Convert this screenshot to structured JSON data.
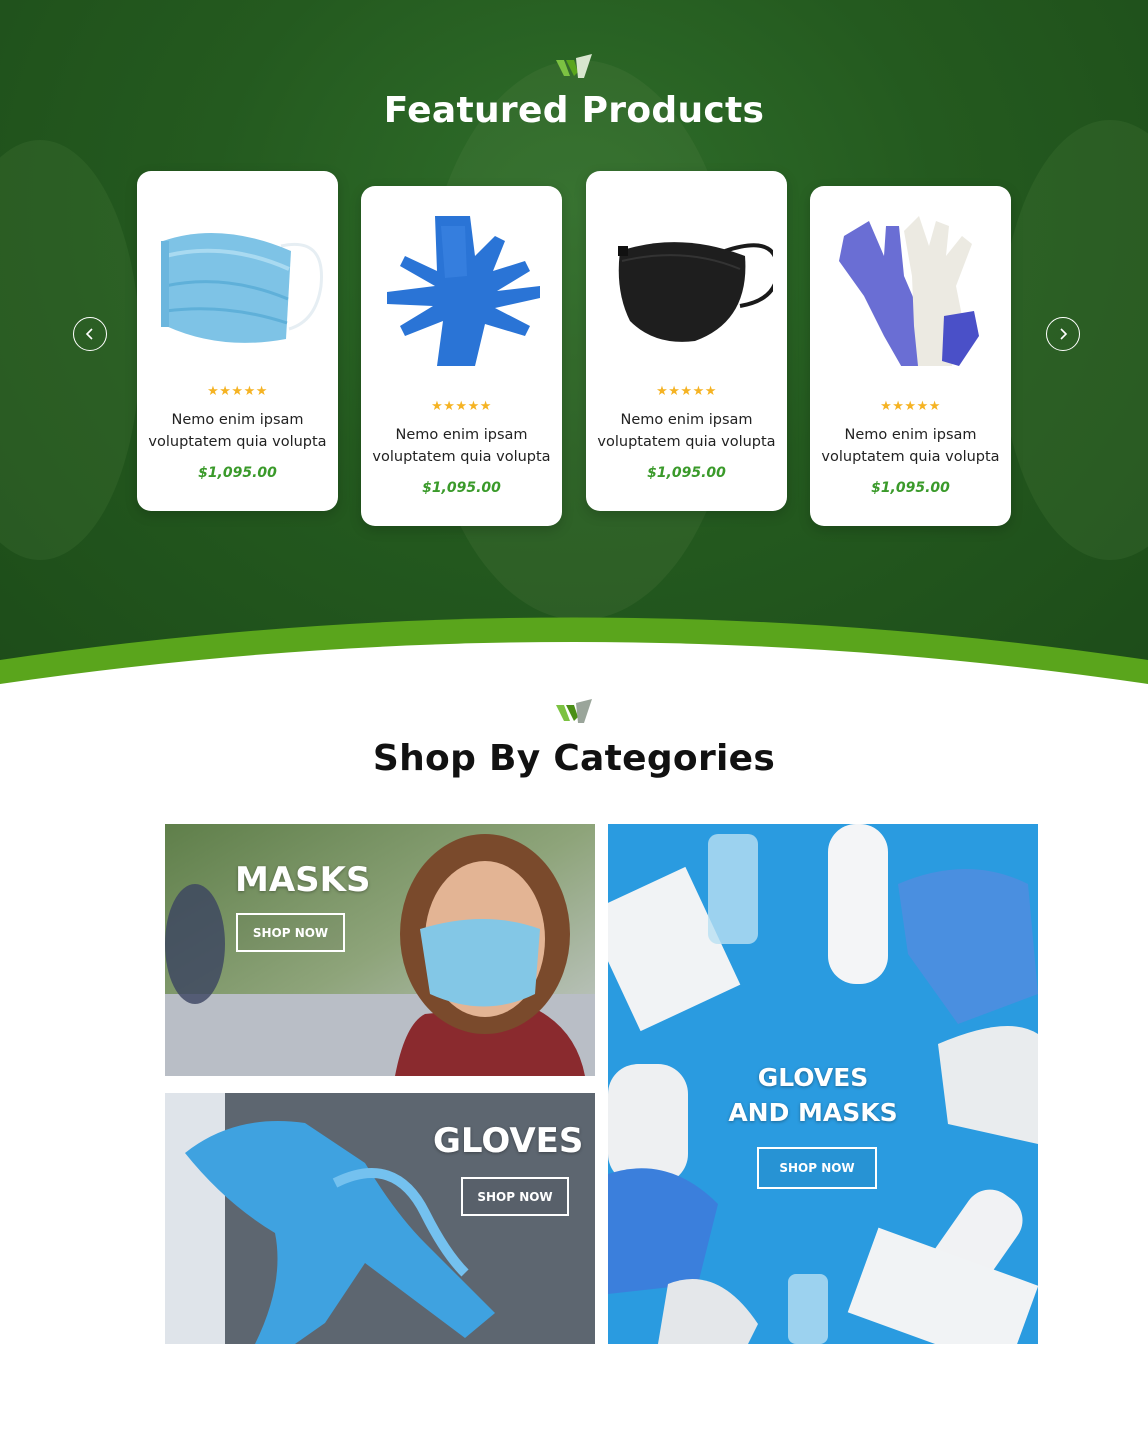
{
  "featured": {
    "title": "Featured Products",
    "logo_icon": "leaf-logo-icon",
    "prev_icon": "chevron-left-icon",
    "next_icon": "chevron-right-icon",
    "products": [
      {
        "image": "surgical-mask-icon",
        "rating": "★★★★★",
        "name": "Nemo enim ipsam voluptatem quia volupta",
        "price": "$1,095.00"
      },
      {
        "image": "blue-gloves-icon",
        "rating": "★★★★★",
        "name": "Nemo enim ipsam voluptatem quia volupta",
        "price": "$1,095.00"
      },
      {
        "image": "black-mask-icon",
        "rating": "★★★★★",
        "name": "Nemo enim ipsam voluptatem quia volupta",
        "price": "$1,095.00"
      },
      {
        "image": "latex-gloves-icon",
        "rating": "★★★★★",
        "name": "Nemo enim ipsam voluptatem quia volupta",
        "price": "$1,095.00"
      }
    ]
  },
  "categories": {
    "title": "Shop By Categories",
    "logo_icon": "leaf-logo-icon",
    "tiles": [
      {
        "title": "MASKS",
        "button": "SHOP NOW"
      },
      {
        "title": "GLOVES",
        "button": "SHOP NOW"
      },
      {
        "title_line1": "GLOVES",
        "title_line2": "AND MASKS",
        "button": "SHOP NOW"
      }
    ]
  },
  "colors": {
    "brand_green": "#245a1f",
    "accent_green": "#5aa51c",
    "price_green": "#3a9a2a",
    "star_gold": "#f5b323",
    "tile_blue": "#2a9be0"
  }
}
